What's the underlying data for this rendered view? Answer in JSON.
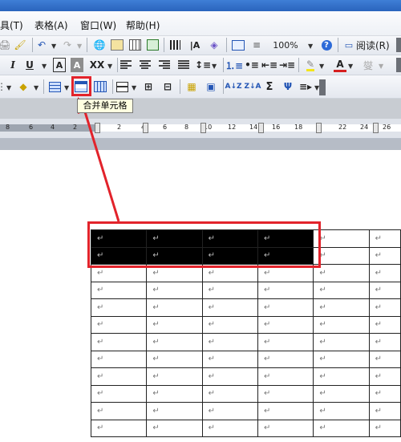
{
  "menubar": {
    "items": [
      {
        "label": "具(T)",
        "name": "menu-tools"
      },
      {
        "label": "表格(A)",
        "name": "menu-table"
      },
      {
        "label": "窗口(W)",
        "name": "menu-window"
      },
      {
        "label": "帮助(H)",
        "name": "menu-help"
      }
    ]
  },
  "toolbar": {
    "zoom_value": "100%",
    "reading_label": "阅读(R)",
    "italic": "I",
    "underline": "U",
    "char_border": "A",
    "char_shading": "A",
    "font_color": "A",
    "phonetic": "燮",
    "sum_glyph": "Σ",
    "sort_asc": "A↓Z",
    "sort_desc": "Z↓A"
  },
  "tooltip": {
    "text": "合并单元格"
  },
  "ruler": {
    "numbers": [
      "8",
      "6",
      "4",
      "2",
      "2",
      "4",
      "6",
      "8",
      "10",
      "12",
      "14",
      "16",
      "18",
      "22",
      "24",
      "26"
    ]
  },
  "table": {
    "cell_mark": "↵",
    "rows": 12,
    "columns": 6,
    "selected_rows": 2,
    "selected_columns": 4
  },
  "colors": {
    "highlight": "#e2232b",
    "selection": "#000000",
    "tooltip_bg": "#ffffe1"
  }
}
